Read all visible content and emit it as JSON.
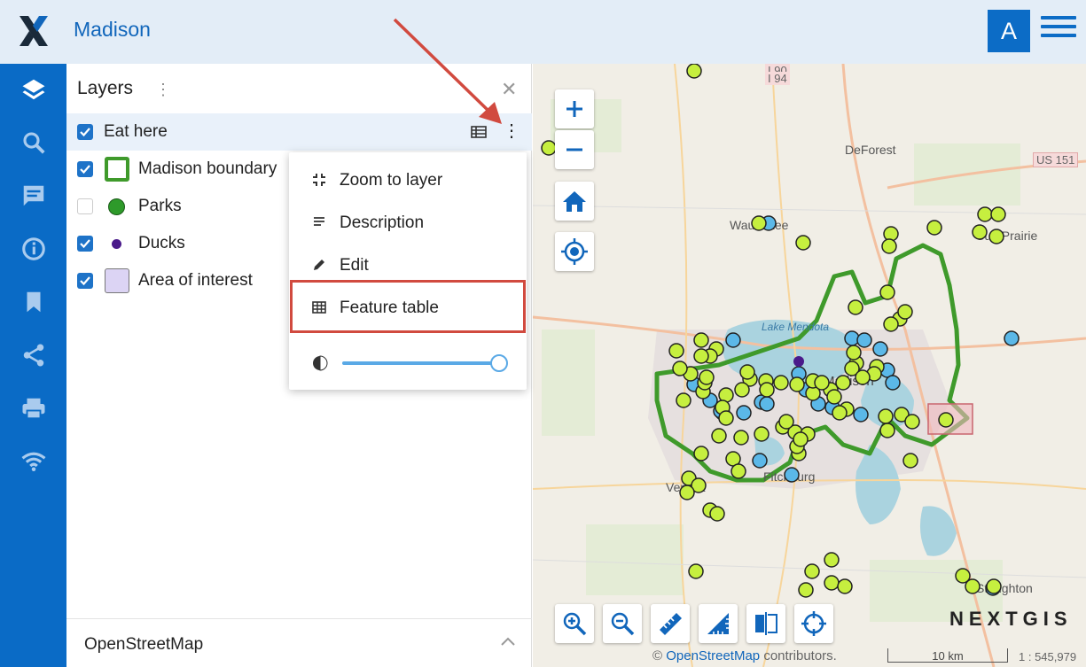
{
  "header": {
    "app_title": "Madison",
    "user_initial": "A"
  },
  "sidebar": {
    "items": [
      {
        "icon": "layers-icon",
        "active": true
      },
      {
        "icon": "search-icon"
      },
      {
        "icon": "comment-icon"
      },
      {
        "icon": "info-icon"
      },
      {
        "icon": "bookmark-icon"
      },
      {
        "icon": "share-icon"
      },
      {
        "icon": "print-icon"
      },
      {
        "icon": "wifi-icon"
      }
    ]
  },
  "panel": {
    "title": "Layers",
    "layers": [
      {
        "label": "Eat here",
        "checked": true
      },
      {
        "label": "Madison boundary",
        "checked": true
      },
      {
        "label": "Parks",
        "checked": false
      },
      {
        "label": "Ducks",
        "checked": true
      },
      {
        "label": "Area of interest",
        "checked": true
      }
    ],
    "basemap_label": "OpenStreetMap"
  },
  "context_menu": {
    "items": [
      {
        "label": "Zoom to layer",
        "icon": "zoom-to-layer-icon"
      },
      {
        "label": "Description",
        "icon": "description-icon"
      },
      {
        "label": "Edit",
        "icon": "edit-icon"
      },
      {
        "label": "Feature table",
        "icon": "table-icon",
        "highlighted": true
      }
    ],
    "opacity": 1.0
  },
  "map": {
    "place_labels": [
      "I 90",
      "I 94",
      "DeForest",
      "US 151",
      "Waunakee",
      "Sun Prairie",
      "Lake Mendota",
      "Madison",
      "Fitchburg",
      "Verona",
      "Stoughton"
    ],
    "attribution_prefix": "©",
    "attribution_link": "OpenStreetMap",
    "attribution_suffix": "contributors.",
    "scale_label": "10 km",
    "scale_ratio": "1 : 545,979",
    "logo_text": "NEXTGIS"
  },
  "colors": {
    "primary": "#0a6bc6",
    "highlight": "#d14a3f",
    "eat_here": "#c6ef3f",
    "ducks": "#5bb8e8",
    "boundary": "#3f9a2b"
  }
}
